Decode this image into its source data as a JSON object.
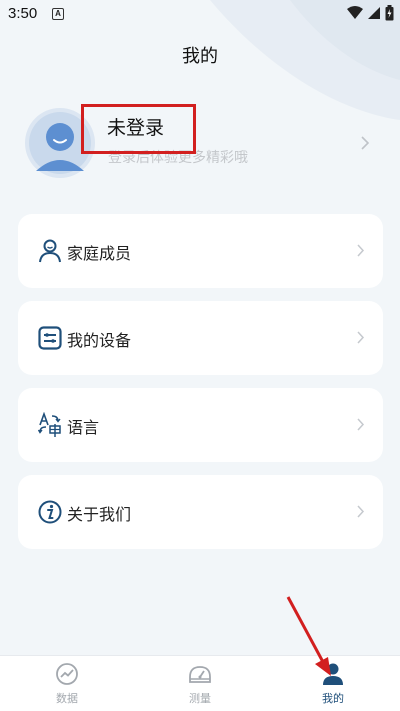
{
  "status_bar": {
    "time": "3:50",
    "notification": "A"
  },
  "header": {
    "title": "我的"
  },
  "profile": {
    "title": "未登录",
    "subtitle": "登录后体验更多精彩哦"
  },
  "menu": [
    {
      "label": "家庭成员",
      "icon": "family-member-icon"
    },
    {
      "label": "我的设备",
      "icon": "device-icon"
    },
    {
      "label": "语言",
      "icon": "language-icon"
    },
    {
      "label": "关于我们",
      "icon": "info-icon"
    }
  ],
  "bottom_nav": [
    {
      "label": "数据",
      "icon": "chart-icon",
      "active": false
    },
    {
      "label": "测量",
      "icon": "gauge-icon",
      "active": false
    },
    {
      "label": "我的",
      "icon": "user-icon",
      "active": true
    }
  ],
  "colors": {
    "accent": "#1f4f7a",
    "highlight": "#d21f1f",
    "muted": "#c4c7cb"
  }
}
